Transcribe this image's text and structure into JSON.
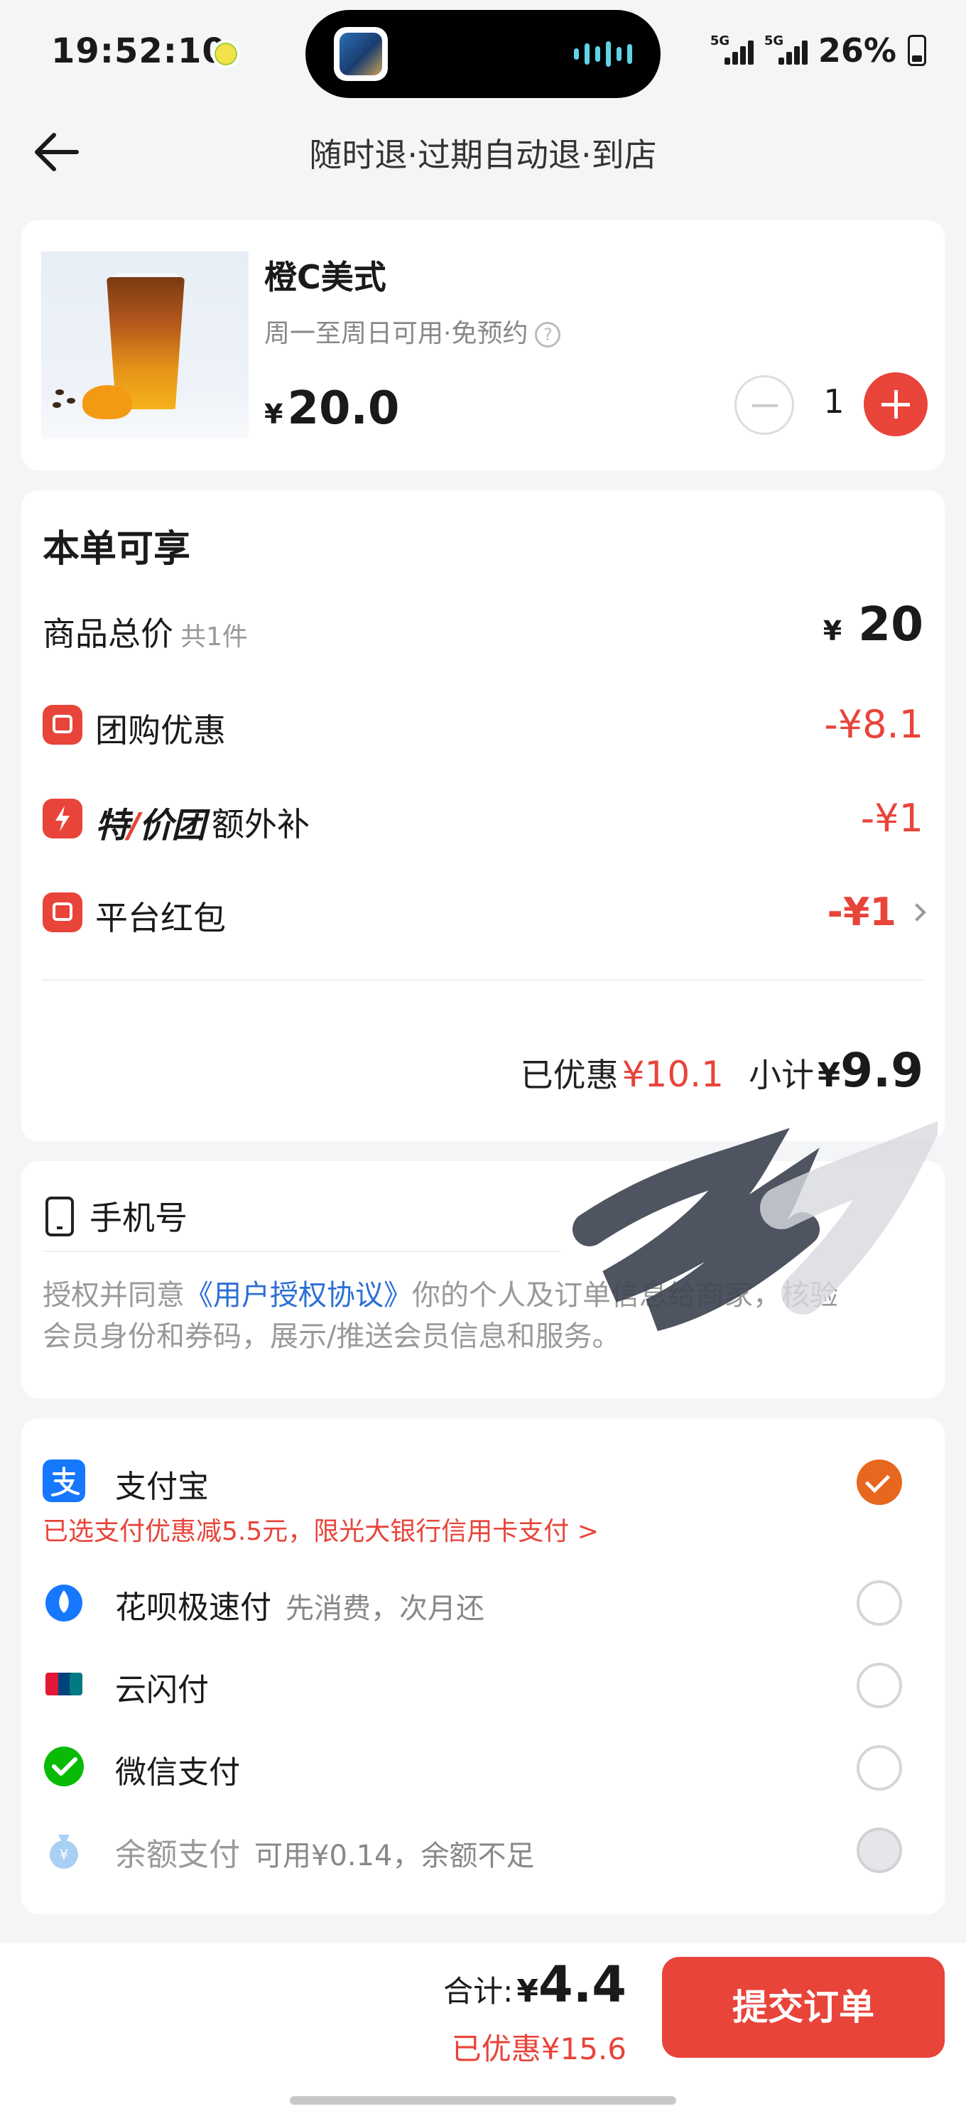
{
  "status_bar": {
    "time": "19:52:10",
    "signal1_label": "5G",
    "signal2_label": "5G",
    "battery": "26%"
  },
  "nav": {
    "title": "随时退·过期自动退·到店",
    "back_icon": "arrow-left-icon"
  },
  "product": {
    "name": "橙C美式",
    "availability": "周一至周日可用·免预约",
    "currency": "¥",
    "price": "20.0",
    "quantity": "1"
  },
  "discounts": {
    "title": "本单可享",
    "items_total_label": "商品总价",
    "items_total_note": "共1件",
    "items_total_currency": "¥",
    "items_total_value": "20",
    "group_buy_label": "团购优惠",
    "group_buy_value": "-¥8.1",
    "special_brand_pre": "特",
    "special_brand_slash": "/",
    "special_brand_post": "价团",
    "special_label": "额外补",
    "special_value": "-¥1",
    "platform_label": "平台红包",
    "platform_value": "-¥1",
    "saved_label": "已优惠",
    "saved_value": "¥10.1",
    "subtotal_label": "小计",
    "subtotal_currency": "¥",
    "subtotal_value": "9.9"
  },
  "phone": {
    "title": "手机号",
    "auth_prefix": "授权并同意",
    "auth_link": "《用户授权协议》",
    "auth_suffix": "你的个人及订单信息给商家，核验会员身份和券码，展示/推送会员信息和服务。"
  },
  "payments": {
    "alipay": "支付宝",
    "alipay_note": "已选支付优惠减5.5元，限光大银行信用卡支付 >",
    "huabei": "花呗极速付",
    "huabei_desc": "先消费，次月还",
    "unionpay": "云闪付",
    "wechat": "微信支付",
    "balance": "余额支付",
    "balance_desc": "可用¥0.14，余额不足"
  },
  "bottom": {
    "total_label": "合计:",
    "total_currency": "¥",
    "total_value": "4.4",
    "saved": "已优惠¥15.6",
    "submit": "提交订单"
  },
  "colors": {
    "accent": "#e8443a",
    "selected": "#e8671e",
    "link": "#2a6fd6"
  }
}
